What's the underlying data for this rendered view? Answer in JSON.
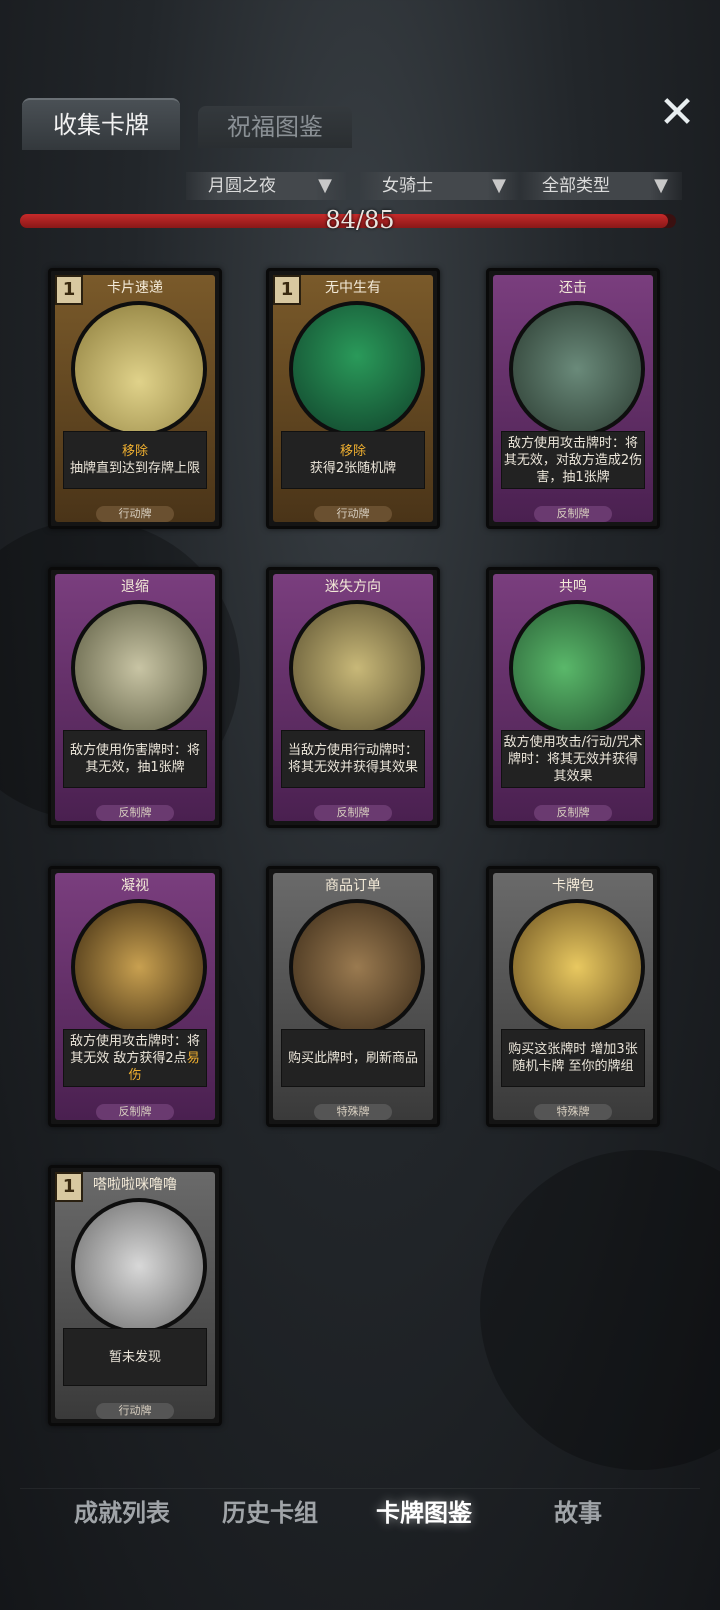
{
  "tabs": {
    "collect": "收集卡牌",
    "bless": "祝福图鉴"
  },
  "close_icon": "close-icon",
  "filters": [
    {
      "label": "月圆之夜",
      "icon": "filter-funnel-icon"
    },
    {
      "label": "女骑士",
      "icon": "filter-funnel-icon"
    },
    {
      "label": "全部类型",
      "icon": "filter-funnel-icon"
    }
  ],
  "progress": {
    "text": "84/85",
    "collected": 84,
    "total": 85
  },
  "cards": [
    {
      "name": "卡片速递",
      "cost": "1",
      "keyword": "移除",
      "desc": "抽牌直到达到存牌上限",
      "type": "行动牌"
    },
    {
      "name": "无中生有",
      "cost": "1",
      "keyword": "移除",
      "desc": "获得2张随机牌",
      "type": "行动牌"
    },
    {
      "name": "还击",
      "cost": "",
      "keyword": "",
      "desc": "敌方使用攻击牌时：将其无效，对敌方造成2伤害，抽1张牌",
      "type": "反制牌"
    },
    {
      "name": "退缩",
      "cost": "",
      "keyword": "",
      "desc": "敌方使用伤害牌时：将其无效，抽1张牌",
      "type": "反制牌"
    },
    {
      "name": "迷失方向",
      "cost": "",
      "keyword": "",
      "desc": "当敌方使用行动牌时：将其无效并获得其效果",
      "type": "反制牌"
    },
    {
      "name": "共鸣",
      "cost": "",
      "keyword": "",
      "desc": "敌方使用攻击/行动/咒术牌时：将其无效并获得其效果",
      "type": "反制牌"
    },
    {
      "name": "凝视",
      "cost": "",
      "keyword": "易伤",
      "desc": "敌方使用攻击牌时：将其无效 敌方获得2点",
      "type": "反制牌"
    },
    {
      "name": "商品订单",
      "cost": "",
      "keyword": "",
      "desc": "购买此牌时，刷新商品",
      "type": "特殊牌"
    },
    {
      "name": "卡牌包",
      "cost": "",
      "keyword": "",
      "desc": "购买这张牌时 增加3张随机卡牌 至你的牌组",
      "type": "特殊牌"
    },
    {
      "name": "嗒啦啦咪噜噜",
      "cost": "1",
      "keyword": "",
      "desc": "暂未发现",
      "type": "行动牌"
    }
  ],
  "bottom_nav": [
    "成就列表",
    "历史卡组",
    "卡牌图鉴",
    "故事"
  ],
  "active_nav": "卡牌图鉴"
}
